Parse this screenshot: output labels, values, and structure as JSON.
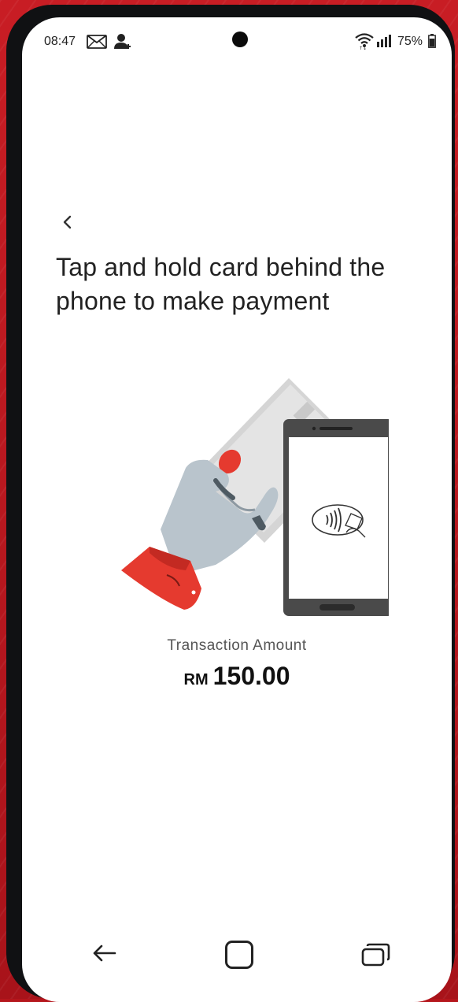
{
  "status_bar": {
    "time": "08:47",
    "battery_percent": "75%",
    "icons": [
      "mail-icon",
      "contact-icon",
      "wifi-icon",
      "signal-icon",
      "battery-icon"
    ]
  },
  "header": {
    "back_icon": "chevron-left-icon"
  },
  "main": {
    "title": "Tap and hold card behind the phone to make payment",
    "illustration": "tap-card-on-phone-illustration",
    "transaction_label": "Transaction Amount",
    "currency": "RM",
    "amount": "150.00"
  },
  "nav_bar": {
    "icons": [
      "back-arrow-icon",
      "home-icon",
      "recents-icon"
    ]
  },
  "colors": {
    "accent_red": "#e53a2f",
    "frame_red": "#b5161c",
    "hand_gray": "#b9c4cc",
    "phone_dark": "#4a4a4a"
  }
}
